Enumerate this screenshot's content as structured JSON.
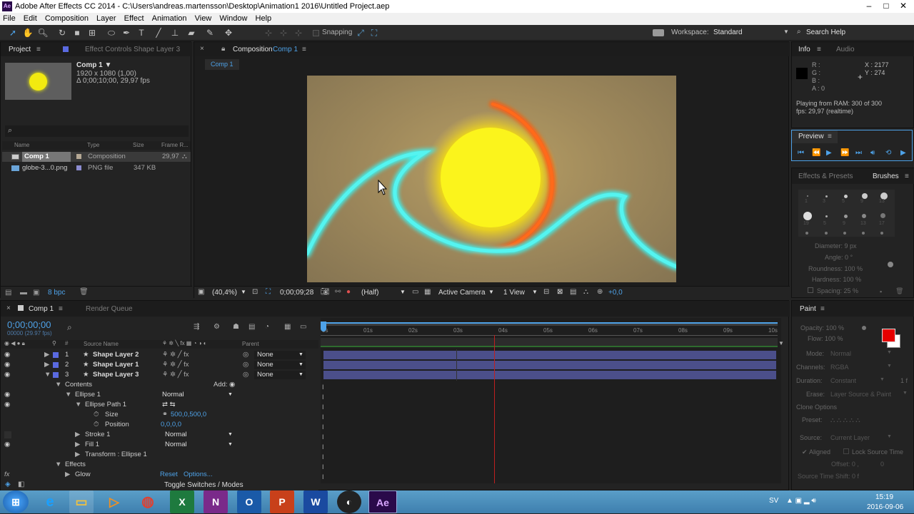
{
  "window": {
    "title": "Adobe After Effects CC 2014 - C:\\Users\\andreas.martensson\\Desktop\\Animation1 2016\\Untitled Project.aep"
  },
  "menu": [
    "File",
    "Edit",
    "Composition",
    "Layer",
    "Effect",
    "Animation",
    "View",
    "Window",
    "Help"
  ],
  "toolbar": {
    "snapping": "Snapping",
    "workspace_label": "Workspace:",
    "workspace_value": "Standard",
    "search": "Search Help"
  },
  "project": {
    "tab": "Project",
    "effect_tab": "Effect Controls Shape Layer 3",
    "preview_name": "Comp 1 ▼",
    "preview_res": "1920 x 1080 (1,00)",
    "preview_dur": "Δ 0;00;10;00, 29,97 fps",
    "columns": [
      "Name",
      "Type",
      "Size",
      "Frame R..."
    ],
    "items": [
      {
        "name": "Comp 1",
        "type": "Composition",
        "size": "",
        "fps": "29,97"
      },
      {
        "name": "globe-3...0.png",
        "type": "PNG file",
        "size": "347 KB",
        "fps": ""
      }
    ],
    "bpc": "8 bpc"
  },
  "composition": {
    "tab_label": "Composition",
    "tab_name": "Comp 1",
    "crumb": "Comp 1",
    "zoom": "(40,4%)",
    "timecode": "0;00;09;28",
    "res": "(Half)",
    "camera": "Active Camera",
    "view": "1 View",
    "exposure": "+0,0"
  },
  "info": {
    "tab": "Info",
    "audio_tab": "Audio",
    "r": "R :",
    "g": "G :",
    "b": "B :",
    "a": "A : 0",
    "x": "X : 2177",
    "y": "Y : 274",
    "ram": "Playing from RAM: 300 of 300",
    "fps": "fps: 29,97 (realtime)"
  },
  "preview": {
    "tab": "Preview"
  },
  "brushes": {
    "effects_tab": "Effects & Presets",
    "tab": "Brushes",
    "row1": [
      "1",
      "3",
      "5",
      "9",
      "13"
    ],
    "row2": [
      "19",
      "5",
      "9",
      "13",
      "17"
    ],
    "diameter": "Diameter: 9 px",
    "angle": "Angle: 0 °",
    "roundness": "Roundness: 100 %",
    "hardness": "Hardness: 100 %",
    "spacing": "Spacing: 25 %"
  },
  "timeline": {
    "tab": "Comp 1",
    "render_tab": "Render Queue",
    "timecode": "0;00;00;00",
    "frame_info": "00000 (29.97 fps)",
    "ruler": [
      "0s",
      "01s",
      "02s",
      "03s",
      "04s",
      "05s",
      "06s",
      "07s",
      "08s",
      "09s",
      "10s"
    ],
    "col_source": "Source Name",
    "col_parent": "Parent",
    "layers": [
      {
        "num": "1",
        "name": "Shape Layer 2",
        "parent": "None"
      },
      {
        "num": "2",
        "name": "Shape Layer 1",
        "parent": "None"
      },
      {
        "num": "3",
        "name": "Shape Layer 3",
        "parent": "None"
      }
    ],
    "contents": "Contents",
    "add": "Add:",
    "ellipse": "Ellipse 1",
    "ellipse_mode": "Normal",
    "ellipse_path": "Ellipse Path 1",
    "size_label": "Size",
    "size_value": "500,0,500,0",
    "position_label": "Position",
    "position_value": "0,0,0,0",
    "stroke": "Stroke 1",
    "stroke_mode": "Normal",
    "fill": "Fill 1",
    "fill_mode": "Normal",
    "transform": "Transform : Ellipse 1",
    "effects": "Effects",
    "glow": "Glow",
    "reset": "Reset",
    "options": "Options...",
    "toggle": "Toggle Switches / Modes"
  },
  "paint": {
    "tab": "Paint",
    "opacity": "Opacity: 100 %",
    "flow": "Flow: 100 %",
    "mode_label": "Mode:",
    "mode_value": "Normal",
    "channels_label": "Channels:",
    "channels_value": "RGBA",
    "duration_label": "Duration:",
    "duration_value": "Constant",
    "duration_f": "1 f",
    "erase_label": "Erase:",
    "erase_value": "Layer Source & Paint",
    "clone": "Clone Options",
    "preset": "Preset:",
    "source_label": "Source:",
    "source_value": "Current Layer",
    "aligned": "Aligned",
    "lock": "Lock Source Time",
    "offset": "Offset: 0 ,",
    "offset2": "0",
    "shift": "Source Time Shift: 0  f",
    "fg_color": "#e60000"
  },
  "taskbar": {
    "lang": "SV",
    "time": "15:19",
    "date": "2016-09-06"
  }
}
